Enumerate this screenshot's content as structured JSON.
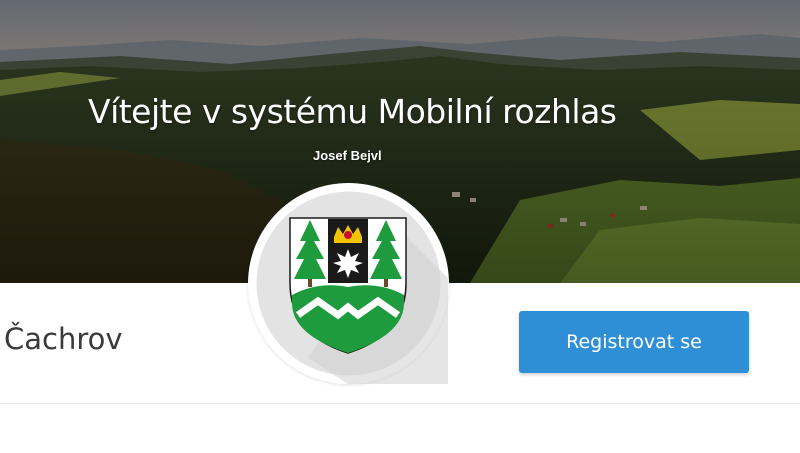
{
  "hero": {
    "title": "Vítejte v systému Mobilní rozhlas",
    "user_name": "Josef Bejvl"
  },
  "town": {
    "name": "Čachrov"
  },
  "actions": {
    "register_label": "Registrovat se"
  },
  "emblem": {
    "icon": "coat-of-arms-icon",
    "colors": {
      "shield_white": "#ffffff",
      "pale_black": "#1a1a1a",
      "crown_gold": "#f2c500",
      "crown_red": "#c8102e",
      "tree_green": "#1e9b3c",
      "mound_green": "#1e9b3c"
    }
  },
  "colors": {
    "accent": "#2f8fd6",
    "text": "#3a3a3a",
    "hero_text": "#ffffff"
  }
}
